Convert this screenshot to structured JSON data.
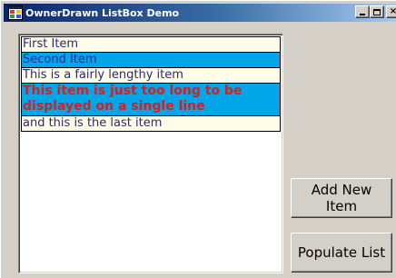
{
  "window": {
    "title": "OwnerDrawn ListBox Demo",
    "icon": "app-window-icon"
  },
  "caption_buttons": {
    "minimize": "minimize-icon",
    "maximize": "maximize-icon",
    "close": "×"
  },
  "listbox": {
    "items": [
      {
        "label": "First Item",
        "style": "light"
      },
      {
        "label": "Second Item",
        "style": "blue"
      },
      {
        "label": "This is a fairly lengthy item",
        "style": "light"
      },
      {
        "label": "This item is just too long to be displayed on a single line",
        "style": "long"
      },
      {
        "label": "and this is the last item",
        "style": "light"
      }
    ]
  },
  "buttons": {
    "add_new_item": "Add New Item",
    "populate_list": "Populate List"
  },
  "colors": {
    "light_item_bg": "#fffde8",
    "selected_item_bg": "#00a6e8",
    "long_item_text": "#d42020",
    "item_text": "#2a2a6e"
  }
}
